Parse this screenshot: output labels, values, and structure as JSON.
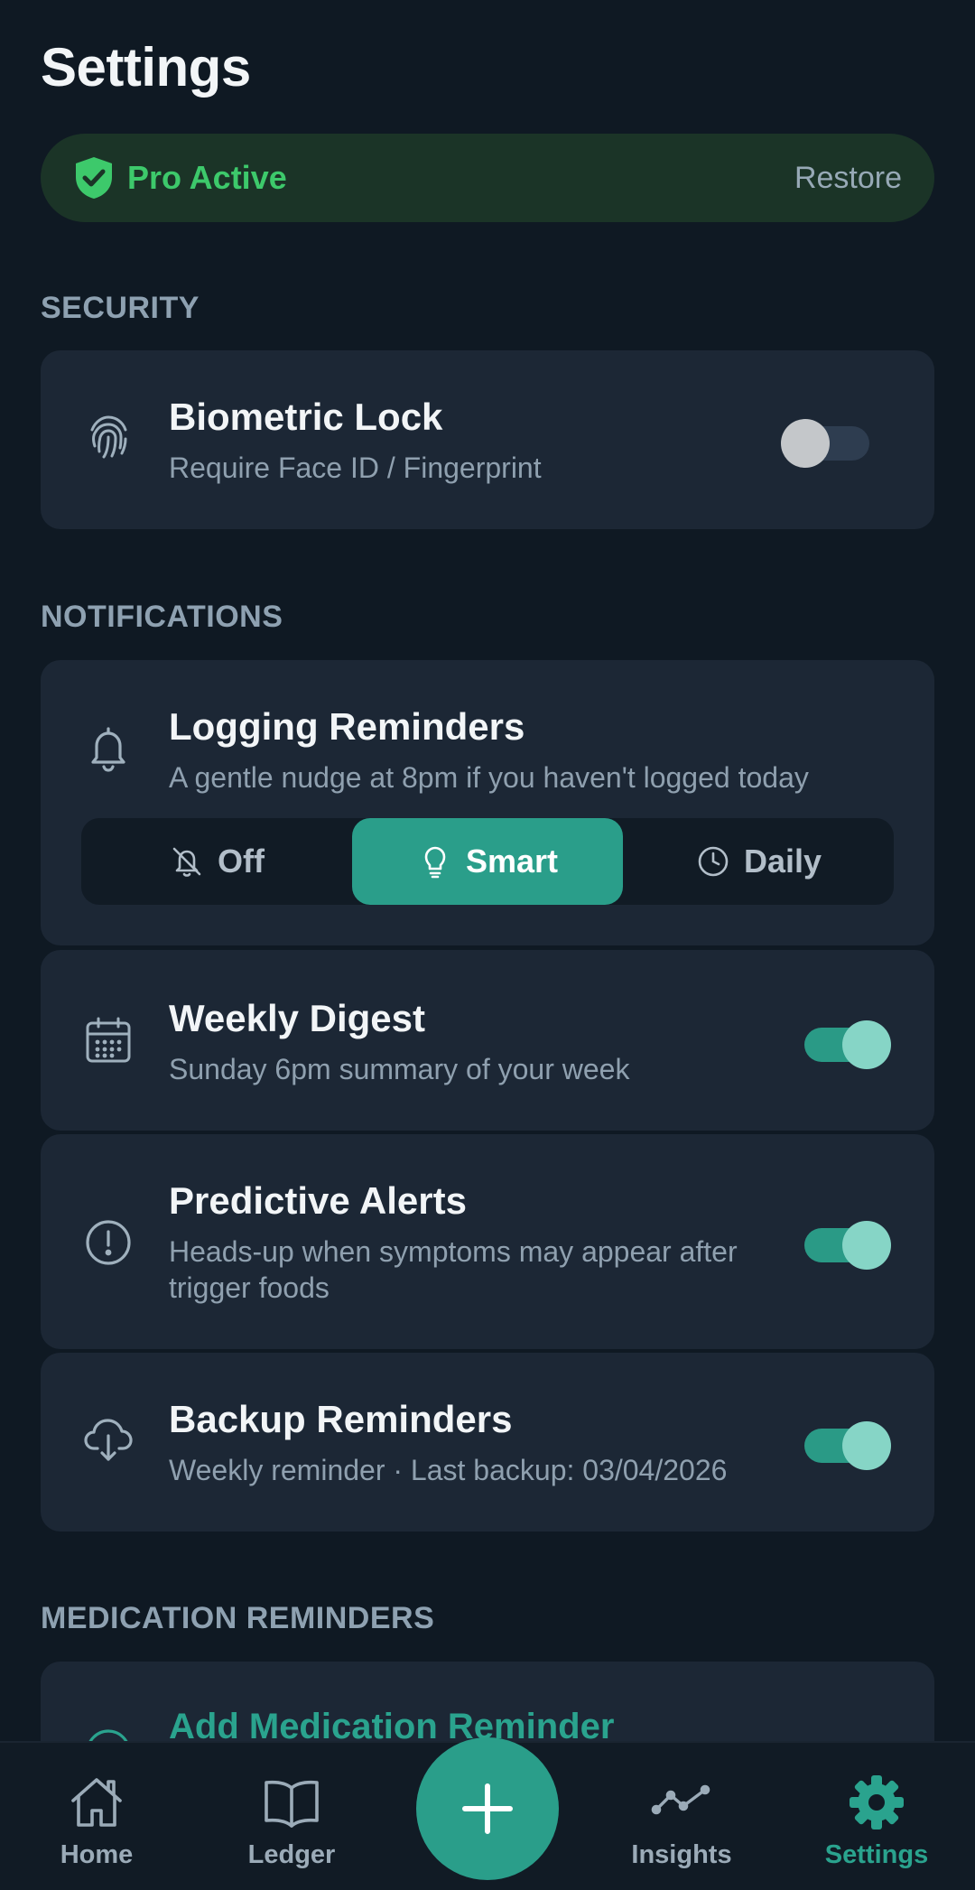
{
  "page": {
    "title": "Settings"
  },
  "pro_banner": {
    "label": "Pro Active",
    "action": "Restore"
  },
  "sections": {
    "security": "SECURITY",
    "notifications": "NOTIFICATIONS",
    "medication": "MEDICATION REMINDERS"
  },
  "security": {
    "biometric": {
      "title": "Biometric Lock",
      "subtitle": "Require Face ID / Fingerprint",
      "enabled": false
    }
  },
  "notifications": {
    "logging": {
      "title": "Logging Reminders",
      "subtitle": "A gentle nudge at 8pm if you haven't logged today",
      "options": [
        "Off",
        "Smart",
        "Daily"
      ],
      "selected": "Smart"
    },
    "weekly_digest": {
      "title": "Weekly Digest",
      "subtitle": "Sunday 6pm summary of your week",
      "enabled": true
    },
    "predictive_alerts": {
      "title": "Predictive Alerts",
      "subtitle": "Heads-up when symptoms may appear after trigger foods",
      "enabled": true
    },
    "backup_reminders": {
      "title": "Backup Reminders",
      "subtitle": "Weekly reminder · Last backup: 03/04/2026",
      "enabled": true
    }
  },
  "medication": {
    "add_label": "Add Medication Reminder"
  },
  "nav": {
    "items": [
      "Home",
      "Ledger",
      "Insights",
      "Settings"
    ],
    "active": "Settings"
  },
  "colors": {
    "background": "#0f1923",
    "card": "#1c2735",
    "accent": "#2a9e8a",
    "pro_green": "#3dc96b"
  },
  "icons": {
    "pro": "shield-check-icon",
    "biometric": "fingerprint-icon",
    "logging": "bell-icon",
    "digest": "calendar-icon",
    "alerts": "alert-circle-icon",
    "backup": "cloud-download-icon",
    "fab": "plus-icon"
  }
}
